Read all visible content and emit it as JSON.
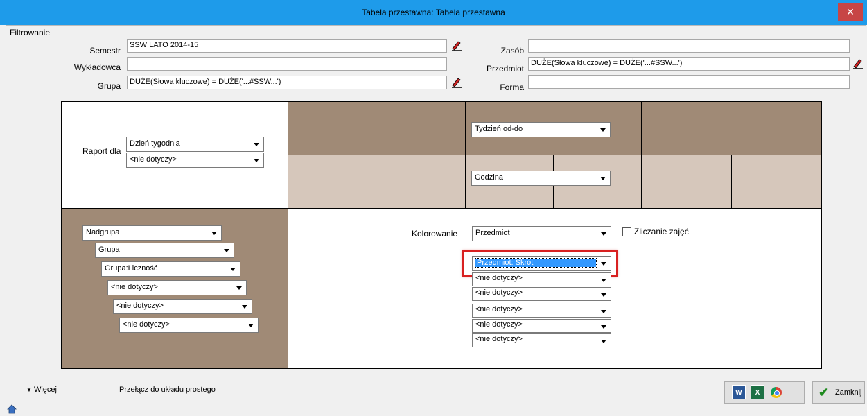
{
  "window": {
    "title": "Tabela przestawna: Tabela przestawna",
    "close_glyph": "✕"
  },
  "filter": {
    "legend": "Filtrowanie",
    "semestr": {
      "label": "Semestr",
      "value": "SSW LATO 2014-15"
    },
    "wykladowca": {
      "label": "Wykładowca",
      "value": ""
    },
    "grupa": {
      "label": "Grupa",
      "value": "DUŻE(Słowa kluczowe) = DUŻE('...#SSW...')"
    },
    "zasob": {
      "label": "Zasób",
      "value": ""
    },
    "przedmiot": {
      "label": "Przedmiot",
      "value": "DUŻE(Słowa kluczowe) = DUŻE('...#SSW...')"
    },
    "forma": {
      "label": "Forma",
      "value": ""
    }
  },
  "report": {
    "label": "Raport dla",
    "combo1": "Dzień tygodnia",
    "combo2": "<nie dotyczy>"
  },
  "columns": {
    "combo1": "Tydzień od-do",
    "combo2": "Godzina"
  },
  "rows": [
    "Nadgrupa",
    "Grupa",
    "Grupa:Liczność",
    "<nie dotyczy>",
    "<nie dotyczy>",
    "<nie dotyczy>"
  ],
  "coloring": {
    "label": "Kolorowanie",
    "value": "Przedmiot",
    "count_label": "Zliczanie zajęć"
  },
  "values": [
    "Przedmiot: Skrót",
    "<nie dotyczy>",
    "<nie dotyczy>",
    "<nie dotyczy>",
    "<nie dotyczy>",
    "<nie dotyczy>"
  ],
  "footer": {
    "more": "Więcej",
    "switch": "Przełącz do układu prostego",
    "close": "Zamknij"
  },
  "colors": {
    "dark": "#a08a76",
    "light": "#d6c7bb",
    "titlebar": "#1e9bea",
    "highlight": "#d82020"
  },
  "icons": [
    "picker-icon",
    "word-icon",
    "excel-icon",
    "chrome-icon",
    "checkmark-icon",
    "home-icon"
  ]
}
